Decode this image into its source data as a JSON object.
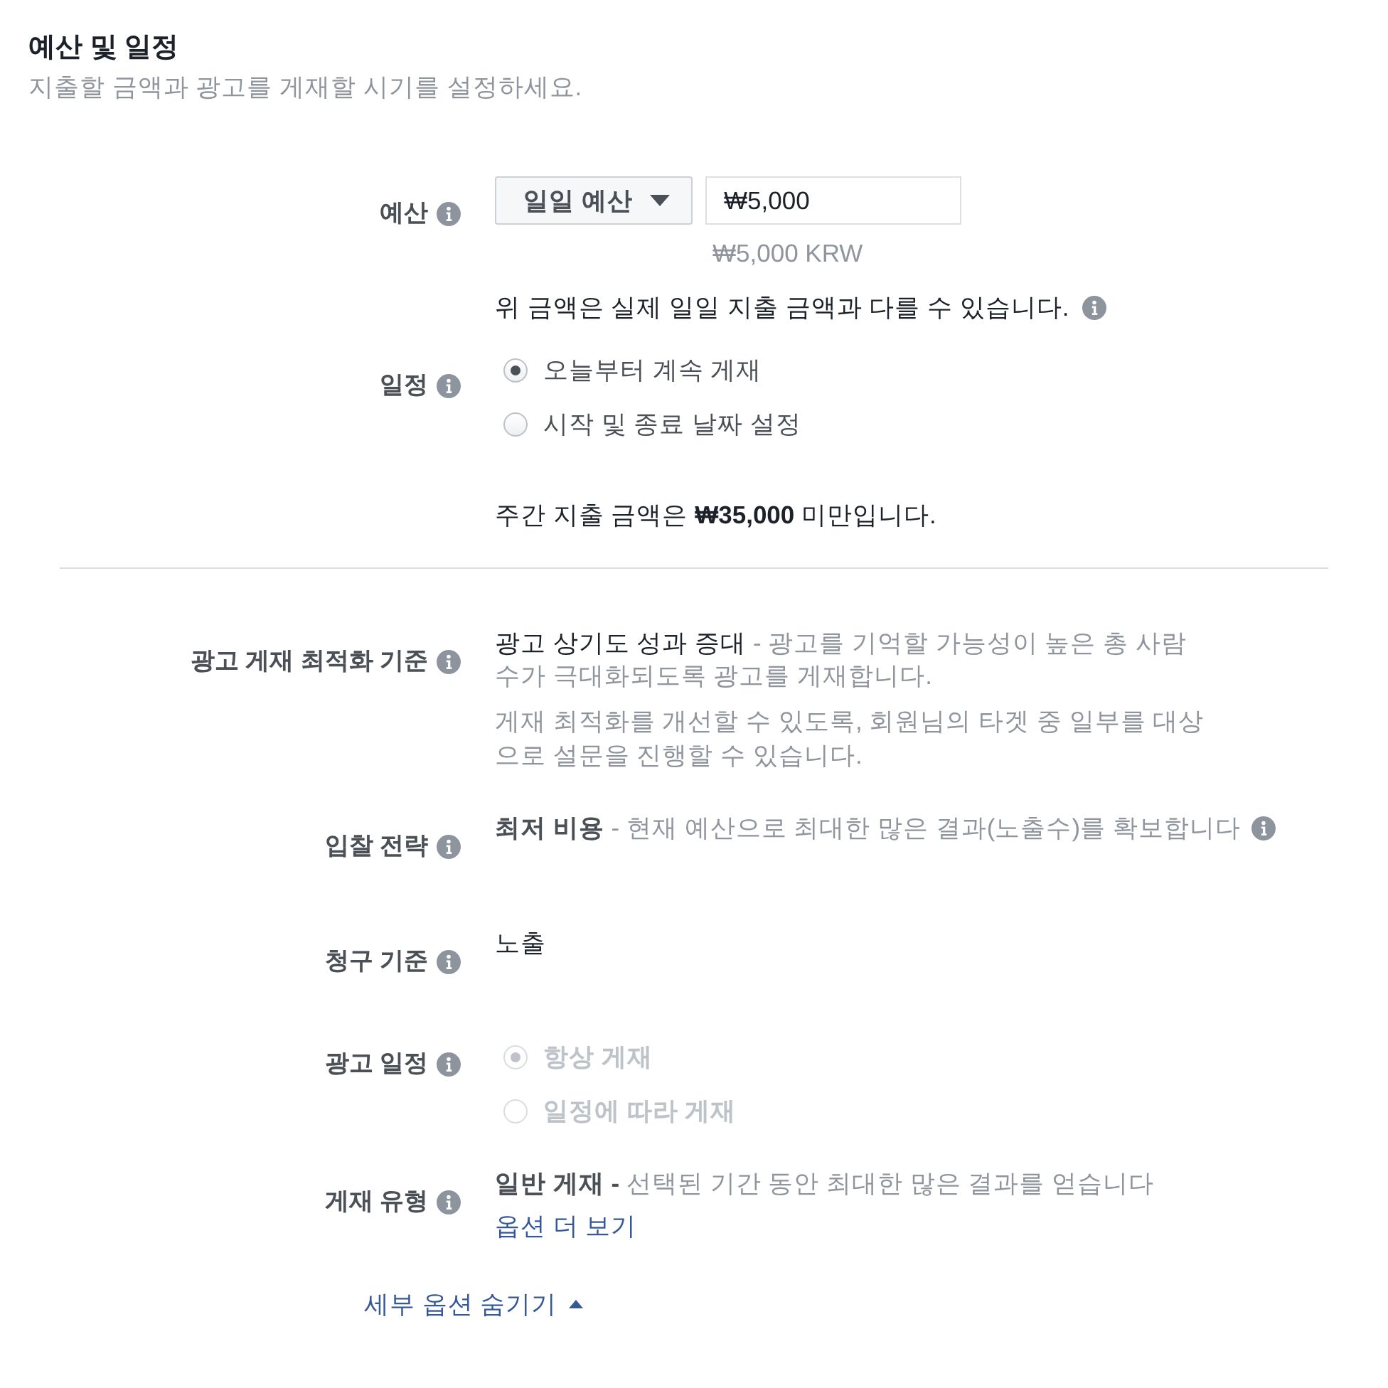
{
  "header": {
    "title": "예산 및 일정",
    "subtitle": "지출할 금액과 광고를 게재할 시기를 설정하세요."
  },
  "budget": {
    "label": "예산",
    "type_dropdown": "일일 예산",
    "amount": "₩5,000",
    "amount_converted": "₩5,000 KRW",
    "note": "위 금액은 실제 일일 지출 금액과 다를 수 있습니다."
  },
  "schedule": {
    "label": "일정",
    "options": [
      {
        "label": "오늘부터 계속 게재",
        "selected": true
      },
      {
        "label": "시작 및 종료 날짜 설정",
        "selected": false
      }
    ],
    "weekly_note": "주간 지출 금액은 **₩35,000** 미만입니다."
  },
  "advanced": [
    {
      "kind": "summary",
      "label": "광고 게재 최적화 기준",
      "title": "광고 상기도 성과 증대",
      "title_bold": false,
      "description": "- 광고를 기억할 가능성이 높은 총 사람 수가 극대화되도록 광고를 게재합니다.",
      "note": "게재 최적화를 개선할 수 있도록, 회원님의 타겟 중 일부를 대상으로 설문을 진행할 수 있습니다."
    },
    {
      "kind": "summary",
      "label": "입찰 전략",
      "title": "최저 비용",
      "title_bold": true,
      "description": "- 현재 예산으로 최대한 많은 결과(노출수)를 확보합니다",
      "info": true
    },
    {
      "kind": "value",
      "label": "청구 기준",
      "value": "노출"
    },
    {
      "kind": "radios",
      "label": "광고 일정",
      "disabled": true,
      "options": [
        {
          "label": "항상 게재",
          "selected": true
        },
        {
          "label": "일정에 따라 게재",
          "selected": false
        }
      ]
    },
    {
      "kind": "summary",
      "label": "게재 유형",
      "title": "일반 게재 -",
      "title_bold": true,
      "description": "선택된 기간 동안 최대한 많은 결과를 얻습니다",
      "link": "옵션 더 보기"
    }
  ],
  "toggle_link": "세부 옵션 숨기기"
}
